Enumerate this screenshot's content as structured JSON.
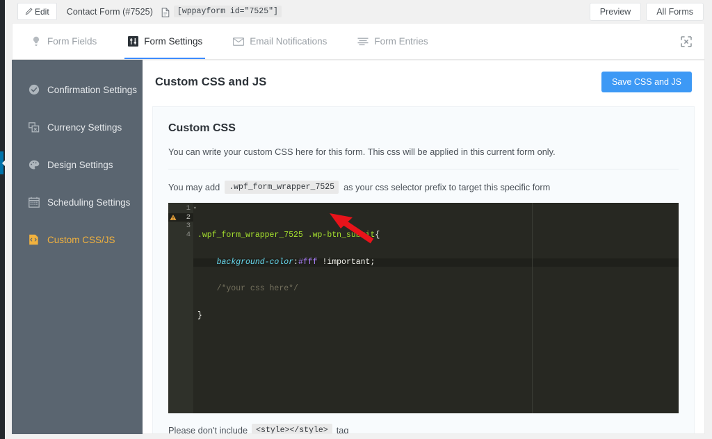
{
  "topbar": {
    "edit_label": "Edit",
    "edit_icon": "pencil-icon",
    "form_title": "Contact Form (#7525)",
    "doc_icon": "document-icon",
    "shortcode": "[wppayform id=\"7525\"]",
    "preview_label": "Preview",
    "all_forms_label": "All Forms"
  },
  "tabs": [
    {
      "label": "Form Fields",
      "icon": "lightbulb-icon",
      "active": false
    },
    {
      "label": "Form Settings",
      "icon": "sliders-icon",
      "active": true
    },
    {
      "label": "Email Notifications",
      "icon": "envelope-icon",
      "active": false
    },
    {
      "label": "Form Entries",
      "icon": "list-icon",
      "active": false
    }
  ],
  "expand_icon": "expand-arrows-icon",
  "sidebar": {
    "items": [
      {
        "label": "Confirmation Settings",
        "icon": "check-circle-icon",
        "active": false
      },
      {
        "label": "Currency Settings",
        "icon": "currency-icon",
        "active": false
      },
      {
        "label": "Design Settings",
        "icon": "palette-icon",
        "active": false
      },
      {
        "label": "Scheduling Settings",
        "icon": "calendar-icon",
        "active": false
      },
      {
        "label": "Custom CSS/JS",
        "icon": "code-file-icon",
        "active": true
      }
    ]
  },
  "main": {
    "panel_title": "Custom CSS and JS",
    "save_label": "Save CSS and JS",
    "css_heading": "Custom CSS",
    "css_description": "You can write your custom CSS here for this form. This css will be applied in this current form only.",
    "prefix_pre": "You may add",
    "prefix_code": ".wpf_form_wrapper_7525",
    "prefix_post": "as your css selector prefix to target this specific form",
    "footer_pre": "Please don't include",
    "footer_code": "<style></style>",
    "footer_post": "tag"
  },
  "editor": {
    "line_numbers": [
      "1",
      "2",
      "3",
      "4"
    ],
    "warning_line": "2",
    "warning_icon": "warning-triangle-icon",
    "fold_line": "1",
    "highlight_line": "2",
    "lines": [
      {
        "n": "1",
        "tokens": [
          {
            "t": ".wpf_form_wrapper_7525 .wp-btn_submit",
            "c": "sel"
          },
          {
            "t": "{",
            "c": "punct"
          }
        ]
      },
      {
        "n": "2",
        "tokens": [
          {
            "t": "    ",
            "c": "punct"
          },
          {
            "t": "background-color",
            "c": "prop"
          },
          {
            "t": ":",
            "c": "punct"
          },
          {
            "t": "#fff",
            "c": "val"
          },
          {
            "t": " !important",
            "c": "imp"
          },
          {
            "t": ";",
            "c": "punct"
          }
        ]
      },
      {
        "n": "3",
        "tokens": [
          {
            "t": "    /*your css here*/",
            "c": "com"
          }
        ]
      },
      {
        "n": "4",
        "tokens": [
          {
            "t": "}",
            "c": "punct"
          }
        ]
      }
    ],
    "code_plain": ".wpf_form_wrapper_7525 .wp-btn_submit{\n    background-color:#fff !important;\n    /*your css here*/\n}"
  },
  "annotation": {
    "type": "red-arrow",
    "color": "#e8131a",
    "points_to": "line 2 end of !important;"
  },
  "colors": {
    "accent_blue": "#3d99f5",
    "tab_underline": "#3d8bfd",
    "sidebar_bg": "#5a6570",
    "sidebar_active_text": "#f2b23e",
    "editor_bg": "#272822",
    "page_bg": "#f1f1f1",
    "wp_rail_bg": "#23282d",
    "wp_rail_active": "#0073aa",
    "annotation_red": "#e8131a"
  }
}
